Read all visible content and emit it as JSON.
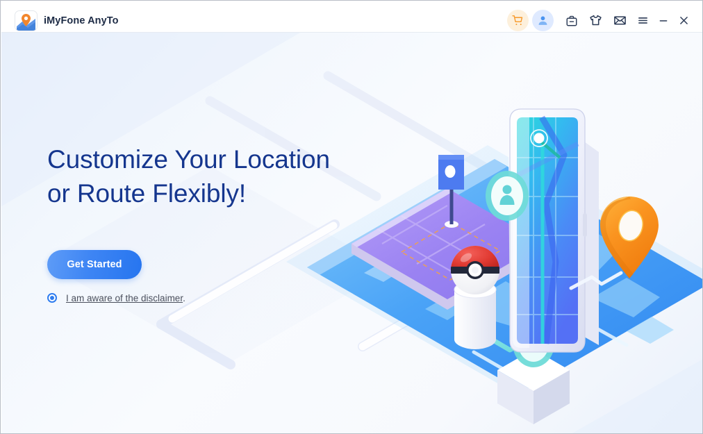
{
  "window": {
    "title": "iMyFone AnyTo",
    "logo_icon": "map-pin-logo"
  },
  "titlebar": {
    "actions": [
      {
        "name": "cart-icon",
        "label": "Shopping cart",
        "color": "#f79a2b",
        "bg": "#fdf0dc"
      },
      {
        "name": "account-icon",
        "label": "Account",
        "color": "#4a93f0",
        "bg": "#dfeaff"
      },
      {
        "name": "briefcase-icon",
        "label": "Products",
        "color": "#2b3a55",
        "bg": "transparent"
      },
      {
        "name": "tshirt-icon",
        "label": "Store",
        "color": "#2b3a55",
        "bg": "transparent"
      },
      {
        "name": "envelope-icon",
        "label": "Feedback",
        "color": "#2b3a55",
        "bg": "transparent"
      },
      {
        "name": "hamburger-menu-icon",
        "label": "Menu",
        "color": "#2b3a55",
        "bg": "transparent"
      },
      {
        "name": "minimize-icon",
        "label": "Minimize",
        "color": "#2b3a55",
        "bg": "transparent"
      },
      {
        "name": "close-icon",
        "label": "Close",
        "color": "#2b3a55",
        "bg": "transparent"
      }
    ]
  },
  "hero": {
    "heading_line1": "Customize Your Location",
    "heading_line2": "or Route Flexibly!",
    "heading_color": "#15368e",
    "cta_label": "Get Started",
    "cta_color": "#2f7def",
    "disclaimer_link": "I am aware of the disclaimer",
    "disclaimer_suffix": ".",
    "disclaimer_checked": true
  },
  "illustration": {
    "name": "isometric-location-spoofing-scene",
    "elements": [
      "blue-world-map-plane",
      "purple-phone-flat",
      "blue-flag-marker",
      "dashed-route-outline",
      "pokeball-on-pedestal",
      "vertical-phone-with-map",
      "avatar-marker-top",
      "avatar-marker-bottom",
      "orange-location-pin",
      "teal-route-path"
    ],
    "colors": {
      "map_blue": "#3d92f5",
      "map_light_blue": "#76c2fb",
      "phone_purple": "#9a7cf0",
      "pin_orange": "#f8941f",
      "screen_teal": "#2ed5de",
      "screen_blue": "#4a7cf7",
      "pokeball_red": "#e43b35"
    }
  }
}
